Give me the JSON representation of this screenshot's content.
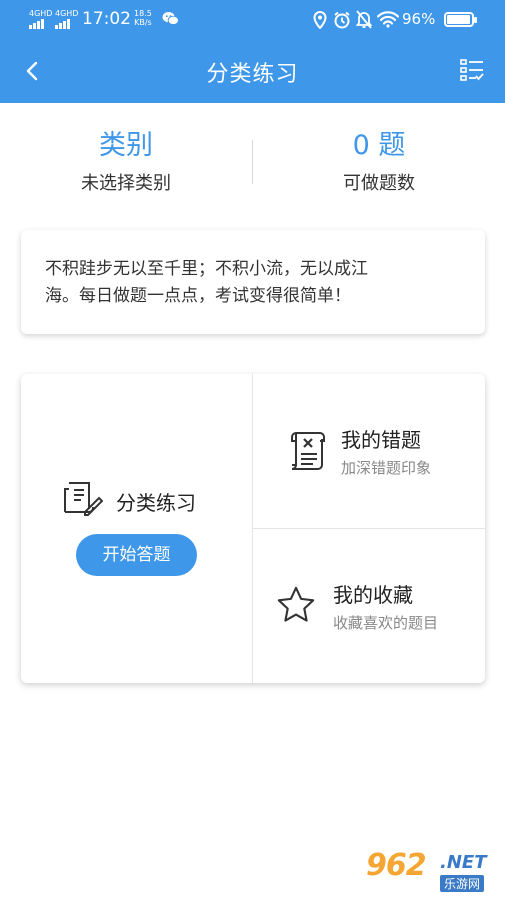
{
  "status_bar": {
    "sim1": "4GHD",
    "sim2": "4GHD",
    "time": "17:02",
    "net_speed_value": "18.5",
    "net_speed_unit": "KB/s",
    "battery_percent": "96%",
    "icons": [
      "wechat-icon",
      "location-icon",
      "alarm-icon",
      "mute-icon",
      "wifi-icon",
      "battery-icon"
    ]
  },
  "header": {
    "title": "分类练习",
    "back_icon": "chevron-left-icon",
    "filter_icon": "filter-list-icon"
  },
  "stats": {
    "category_value": "类别",
    "category_label": "未选择类别",
    "count_value": "0 题",
    "count_label": "可做题数"
  },
  "quote": {
    "line1": "不积跬步无以至千里；不积小流，无以成江",
    "line2": "海。每日做题一点点，考试变得很简单！"
  },
  "practice": {
    "title": "分类练习",
    "start_button": "开始答题",
    "icon": "writing-notes-icon"
  },
  "wrong_questions": {
    "title": "我的错题",
    "subtitle": "加深错题印象",
    "icon": "error-scroll-icon"
  },
  "favorites": {
    "title": "我的收藏",
    "subtitle": "收藏喜欢的题目",
    "icon": "star-icon"
  },
  "watermark": {
    "brand": "962",
    "suffix": ".NET",
    "sub": "乐游网"
  },
  "colors": {
    "accent": "#3f97e9",
    "background": "#ffffff",
    "subtitle_gray": "#888888"
  }
}
